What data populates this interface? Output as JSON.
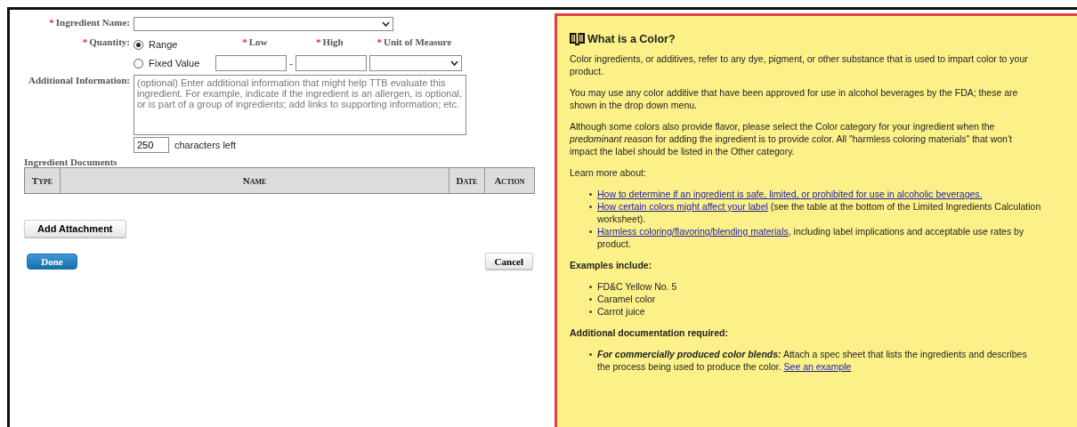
{
  "form": {
    "ingredient_name": {
      "marker": "*",
      "label": "Ingredient Name:"
    },
    "quantity": {
      "marker": "*",
      "label": "Quantity:",
      "options": [
        {
          "label": "Range",
          "selected": true
        },
        {
          "label": "Fixed Value",
          "selected": false
        }
      ],
      "columns": [
        {
          "marker": "*",
          "label": "Low"
        },
        {
          "marker": "*",
          "label": "High"
        },
        {
          "marker": "*",
          "label": "Unit of Measure"
        }
      ],
      "separator": "-"
    },
    "additional_information": {
      "label": "Additional Information:",
      "placeholder": "(optional) Enter additional information that might help TTB evaluate this ingredient. For example, indicate if the ingredient is an allergen, is optional, or is part of a group of ingredients; add links to supporting information; etc.",
      "counter": "250",
      "counter_label": "characters left"
    },
    "documents": {
      "title": "Ingredient Documents",
      "columns": [
        "Type",
        "Name",
        "Date",
        "Action"
      ]
    },
    "buttons": {
      "attach": "Add Attachment",
      "done": "Done",
      "cancel": "Cancel"
    }
  },
  "help": {
    "title": "What is a Color?",
    "paragraphs": [
      "Color ingredients, or additives, refer to any dye, pigment, or other substance that is used to impart color to your product.",
      "You may use any color additive that have been approved for use in alcohol beverages by the FDA; these are shown in the drop down menu.",
      "Although some colors also provide flavor, please select the Color category for your ingredient when the *predominant reason* for adding the ingredient is to provide color. All \"harmless coloring materials\" that won't impact the label should be listed in the Other category."
    ],
    "learn_more": "Learn more about:",
    "links": [
      {
        "link": "How to determine if an ingredient is safe, limited, or prohibited for use in alcoholic beverages."
      },
      {
        "link": "How certain colors might affect your label",
        "text": " (see the table at the bottom of the Limited Ingredients Calculation worksheet)."
      },
      {
        "link": "Harmless coloring/flavoring/blending materials",
        "text": ", including label implications and acceptable use rates by product."
      }
    ],
    "examples_title": "Examples include:",
    "examples": [
      "FD&C Yellow No. 5",
      "Caramel color",
      "Carrot juice"
    ],
    "docs_title": "Additional documentation required:",
    "docs": [
      {
        "lead": "For commercially produced color blends:",
        "text": " Attach a spec sheet that lists the ingredients and describes the process being used to produce the color. ",
        "link": "See an example"
      }
    ]
  }
}
